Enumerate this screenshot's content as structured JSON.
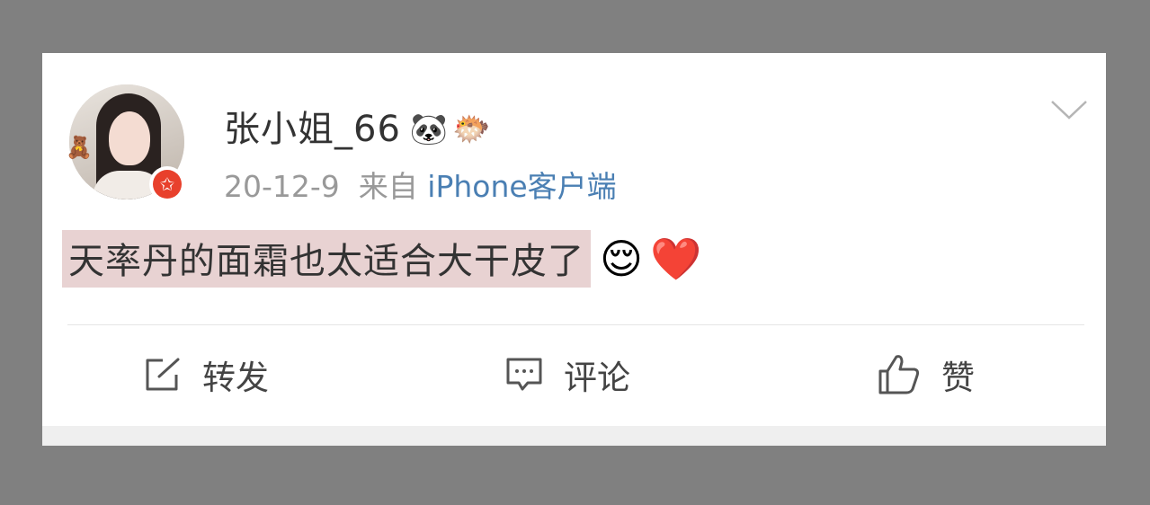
{
  "post": {
    "username": "张小姐_66",
    "user_badges": [
      "panda-icon",
      "fish-icon"
    ],
    "avatar_badges": [
      "teddy-bear-icon",
      "verified-star-badge"
    ],
    "date": "20-12-9",
    "from_label": "来自",
    "source": "iPhone客户端",
    "content": "天率丹的面霜也太适合大干皮了",
    "emojis": [
      "😌",
      "❤️"
    ]
  },
  "actions": {
    "repost_label": "转发",
    "comment_label": "评论",
    "like_label": "赞"
  },
  "colors": {
    "background": "#808080",
    "card": "#ffffff",
    "highlight": "#e8d2d2",
    "link": "#4a7fb3",
    "meta": "#999999",
    "verified_badge": "#e8402c"
  }
}
